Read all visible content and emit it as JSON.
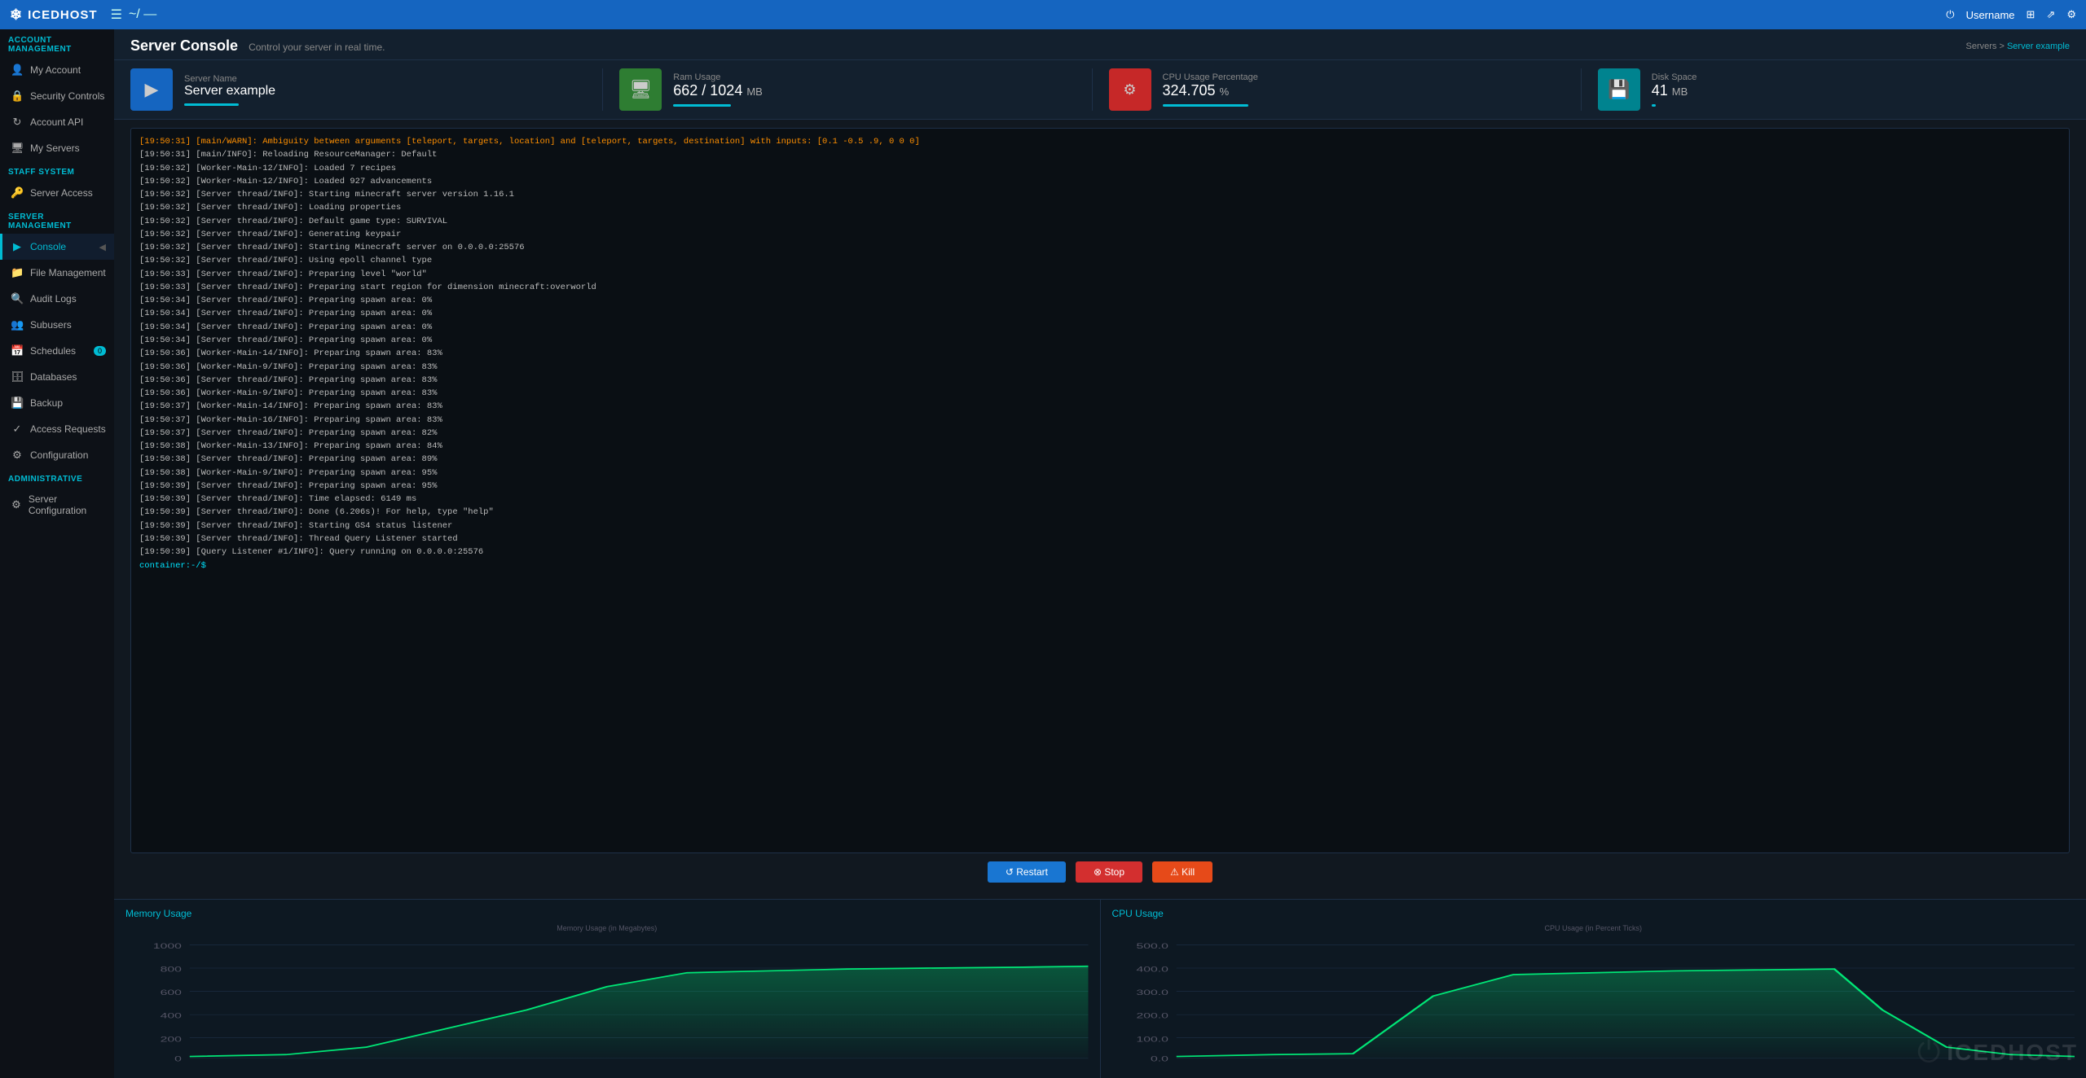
{
  "topnav": {
    "logo": "ICEDHOST",
    "logo_icon": "❄",
    "menu_icon": "☰",
    "branch": "~/ —",
    "username": "Username",
    "power_icon": "⏻",
    "grid_icon": "⊞",
    "share_icon": "⇗",
    "settings_icon": "⚙"
  },
  "sidebar": {
    "account_section": "ACCOUNT MANAGEMENT",
    "items_account": [
      {
        "label": "My Account",
        "icon": "👤",
        "active": false
      },
      {
        "label": "Security Controls",
        "icon": "🔒",
        "active": false
      },
      {
        "label": "Account API",
        "icon": "↻",
        "active": false
      },
      {
        "label": "My Servers",
        "icon": "🖥",
        "active": false
      }
    ],
    "staff_section": "Staff System",
    "items_staff": [
      {
        "label": "Server Access",
        "icon": "🔑",
        "active": false
      }
    ],
    "server_section": "SERVER MANAGEMENT",
    "items_server": [
      {
        "label": "Console",
        "icon": "▶",
        "active": true
      },
      {
        "label": "File Management",
        "icon": "📁",
        "active": false
      },
      {
        "label": "Audit Logs",
        "icon": "🔍",
        "active": false
      },
      {
        "label": "Subusers",
        "icon": "👥",
        "active": false
      },
      {
        "label": "Schedules",
        "icon": "📅",
        "badge": "0",
        "active": false
      },
      {
        "label": "Databases",
        "icon": "🗄",
        "active": false
      },
      {
        "label": "Backup",
        "icon": "💾",
        "active": false
      },
      {
        "label": "Access Requests",
        "icon": "✓",
        "active": false
      },
      {
        "label": "Configuration",
        "icon": "⚙",
        "active": false
      }
    ],
    "admin_section": "ADMINISTRATIVE",
    "items_admin": [
      {
        "label": "Server Configuration",
        "icon": "⚙",
        "active": false
      }
    ]
  },
  "page": {
    "title": "Server Console",
    "subtitle": "Control your server in real time.",
    "breadcrumb_servers": "Servers",
    "breadcrumb_current": "Server example"
  },
  "stats": [
    {
      "icon": "▶",
      "icon_class": "blue",
      "label": "Server Name",
      "value": "Server example",
      "bar_width": "60%"
    },
    {
      "icon": "🖥",
      "icon_class": "green",
      "label": "Ram Usage",
      "value": "662 / 1024",
      "unit": "MB",
      "bar_width": "65%"
    },
    {
      "icon": "⚙",
      "icon_class": "red",
      "label": "CPU Usage Percentage",
      "value": "324.705",
      "unit": "%",
      "bar_width": "90%"
    },
    {
      "icon": "💾",
      "icon_class": "teal",
      "label": "Disk Space",
      "value": "41",
      "unit": "MB",
      "bar_width": "10%"
    }
  ],
  "console": {
    "lines": [
      "[19:50:31] [main/WARN]: Ambiguity between arguments [teleport, targets, location] and [teleport, targets, destination] with inputs: [0.1 -0.5 .9, 0 0 0]",
      "[19:50:31] [main/INFO]: Reloading ResourceManager: Default",
      "[19:50:32] [Worker-Main-12/INFO]: Loaded 7 recipes",
      "[19:50:32] [Worker-Main-12/INFO]: Loaded 927 advancements",
      "[19:50:32] [Server thread/INFO]: Starting minecraft server version 1.16.1",
      "[19:50:32] [Server thread/INFO]: Loading properties",
      "[19:50:32] [Server thread/INFO]: Default game type: SURVIVAL",
      "[19:50:32] [Server thread/INFO]: Generating keypair",
      "[19:50:32] [Server thread/INFO]: Starting Minecraft server on 0.0.0.0:25576",
      "[19:50:32] [Server thread/INFO]: Using epoll channel type",
      "[19:50:33] [Server thread/INFO]: Preparing level \"world\"",
      "[19:50:33] [Server thread/INFO]: Preparing start region for dimension minecraft:overworld",
      "[19:50:34] [Server thread/INFO]: Preparing spawn area: 0%",
      "[19:50:34] [Server thread/INFO]: Preparing spawn area: 0%",
      "[19:50:34] [Server thread/INFO]: Preparing spawn area: 0%",
      "[19:50:34] [Server thread/INFO]: Preparing spawn area: 0%",
      "[19:50:36] [Worker-Main-14/INFO]: Preparing spawn area: 83%",
      "[19:50:36] [Worker-Main-9/INFO]: Preparing spawn area: 83%",
      "[19:50:36] [Server thread/INFO]: Preparing spawn area: 83%",
      "[19:50:36] [Worker-Main-9/INFO]: Preparing spawn area: 83%",
      "[19:50:37] [Worker-Main-14/INFO]: Preparing spawn area: 83%",
      "[19:50:37] [Worker-Main-16/INFO]: Preparing spawn area: 83%",
      "[19:50:37] [Server thread/INFO]: Preparing spawn area: 82%",
      "[19:50:38] [Worker-Main-13/INFO]: Preparing spawn area: 84%",
      "[19:50:38] [Server thread/INFO]: Preparing spawn area: 89%",
      "[19:50:38] [Worker-Main-9/INFO]: Preparing spawn area: 95%",
      "[19:50:39] [Server thread/INFO]: Preparing spawn area: 95%",
      "[19:50:39] [Server thread/INFO]: Time elapsed: 6149 ms",
      "[19:50:39] [Server thread/INFO]: Done (6.206s)! For help, type \"help\"",
      "",
      "[19:50:39] [Server thread/INFO]: Starting GS4 status listener",
      "[19:50:39] [Server thread/INFO]: Thread Query Listener started",
      "[19:50:39] [Query Listener #1/INFO]: Query running on 0.0.0.0:25576",
      "container:-/$"
    ]
  },
  "controls": {
    "restart_label": "↺ Restart",
    "stop_label": "⊗ Stop",
    "kill_label": "⚠ Kill"
  },
  "charts": {
    "memory": {
      "title": "Memory Usage",
      "y_label": "Memory Usage (in Megabytes)"
    },
    "cpu": {
      "title": "CPU Usage",
      "y_label": "CPU Usage (in Percent Ticks)"
    }
  },
  "watermark": {
    "text": "ICEDHOST"
  }
}
